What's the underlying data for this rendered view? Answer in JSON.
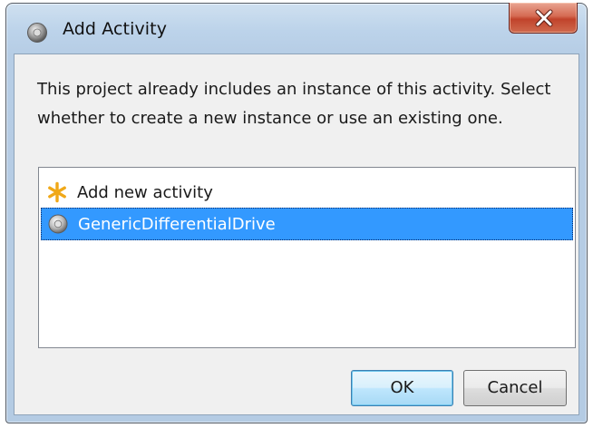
{
  "window": {
    "title": "Add Activity",
    "app_icon": "gear-icon",
    "close_icon": "close-icon"
  },
  "message": "This project already includes an instance of this activity. Select whether to create a new instance or use an existing one.",
  "activity_list": {
    "items": [
      {
        "label": "Add new activity",
        "icon": "asterisk-icon",
        "selected": false
      },
      {
        "label": "GenericDifferentialDrive",
        "icon": "gear-icon",
        "selected": true
      }
    ]
  },
  "buttons": {
    "ok_label": "OK",
    "cancel_label": "Cancel"
  },
  "colors": {
    "selection": "#3399ff",
    "asterisk": "#f0a818",
    "close_button": "#c7432b"
  }
}
